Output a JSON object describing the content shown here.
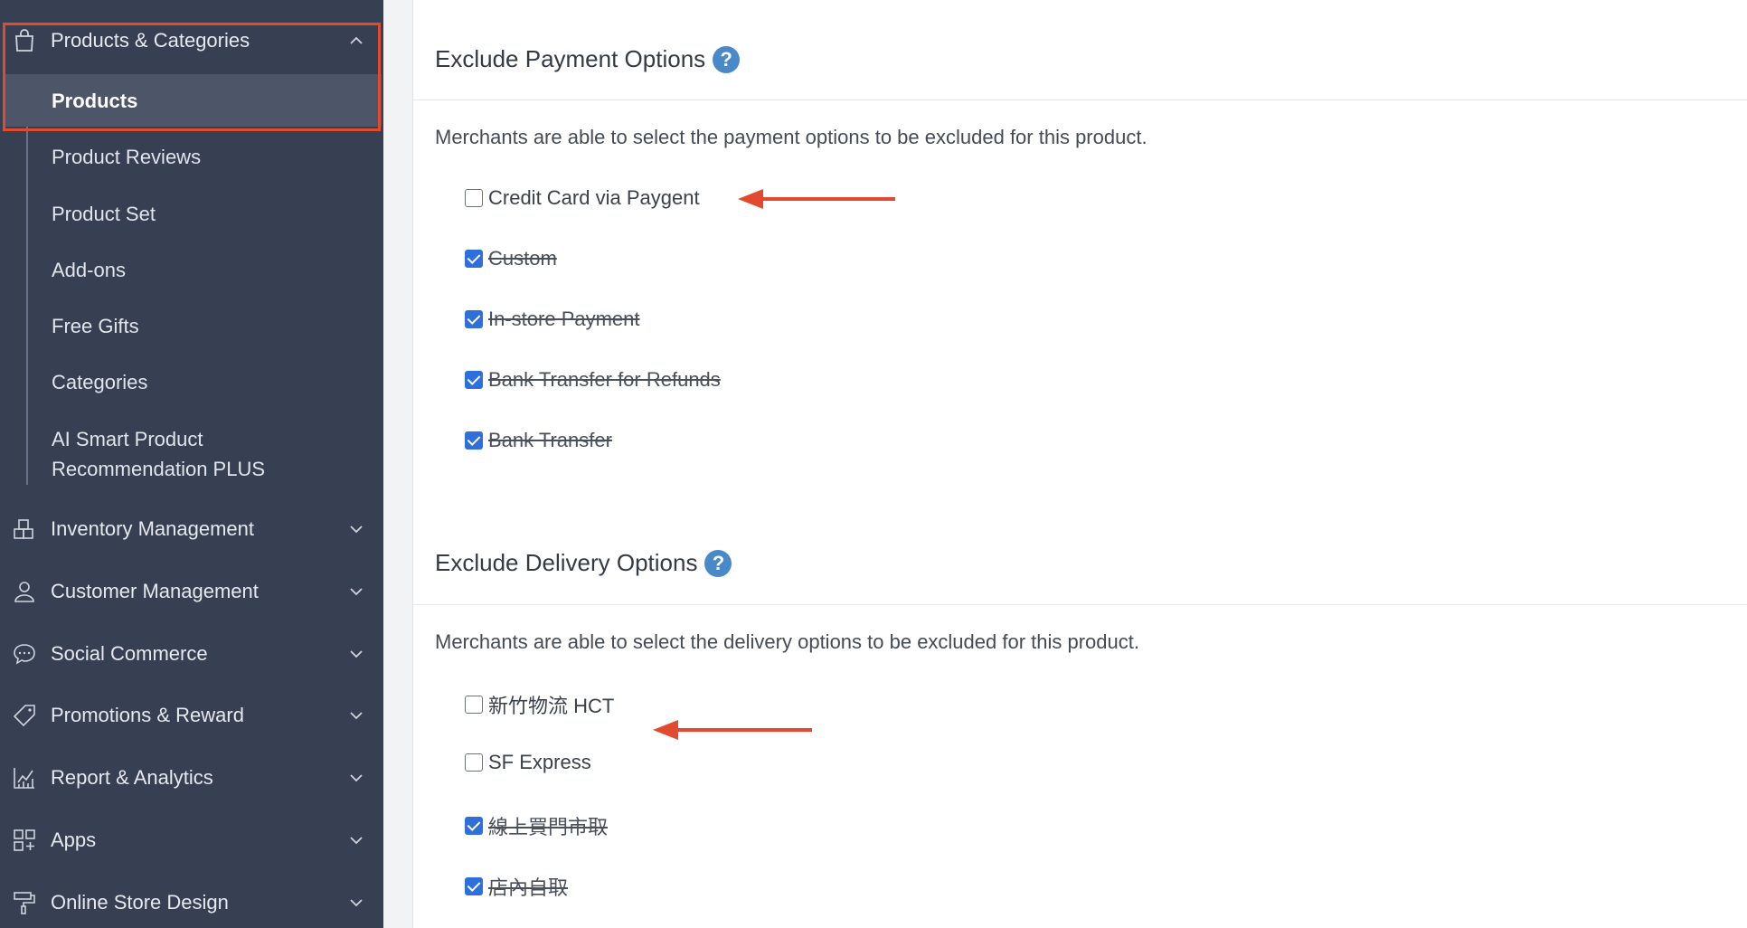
{
  "sidebar": {
    "groups_top": {
      "products_categories": "Products & Categories"
    },
    "sub_items": [
      {
        "label": "Products",
        "active": true
      },
      {
        "label": "Product Reviews"
      },
      {
        "label": "Product Set"
      },
      {
        "label": "Add-ons"
      },
      {
        "label": "Free Gifts"
      },
      {
        "label": "Categories"
      },
      {
        "label": "AI Smart Product Recommendation PLUS"
      }
    ],
    "groups": [
      {
        "label": "Inventory Management",
        "icon": "inventory-icon"
      },
      {
        "label": "Customer Management",
        "icon": "user-icon"
      },
      {
        "label": "Social Commerce",
        "icon": "chat-bubble-icon"
      },
      {
        "label": "Promotions & Reward",
        "icon": "tag-icon"
      },
      {
        "label": "Report & Analytics",
        "icon": "chart-icon"
      },
      {
        "label": "Apps",
        "icon": "apps-icon"
      },
      {
        "label": "Online Store Design",
        "icon": "paint-roller-icon"
      }
    ]
  },
  "payment": {
    "title": "Exclude Payment Options",
    "description": "Merchants are able to select the payment options to be excluded for this product.",
    "options": [
      {
        "label": "Credit Card via Paygent",
        "checked": false
      },
      {
        "label": "Custom",
        "checked": true
      },
      {
        "label": "In-store Payment",
        "checked": true
      },
      {
        "label": "Bank Transfer for Refunds",
        "checked": true
      },
      {
        "label": "Bank Transfer",
        "checked": true
      }
    ]
  },
  "delivery": {
    "title": "Exclude Delivery Options",
    "description": "Merchants are able to select the delivery options to be excluded for this product.",
    "options": [
      {
        "label": "新竹物流 HCT",
        "checked": false
      },
      {
        "label": "SF Express",
        "checked": false
      },
      {
        "label": "線上買門市取",
        "checked": true
      },
      {
        "label": "店內自取",
        "checked": true
      }
    ]
  },
  "colors": {
    "sidebar_bg": "#373f52",
    "active_bg": "#4d5568",
    "annotation_red": "#e24a2f",
    "checkbox_blue": "#2f6fdc",
    "help_blue": "#4a89c8"
  }
}
